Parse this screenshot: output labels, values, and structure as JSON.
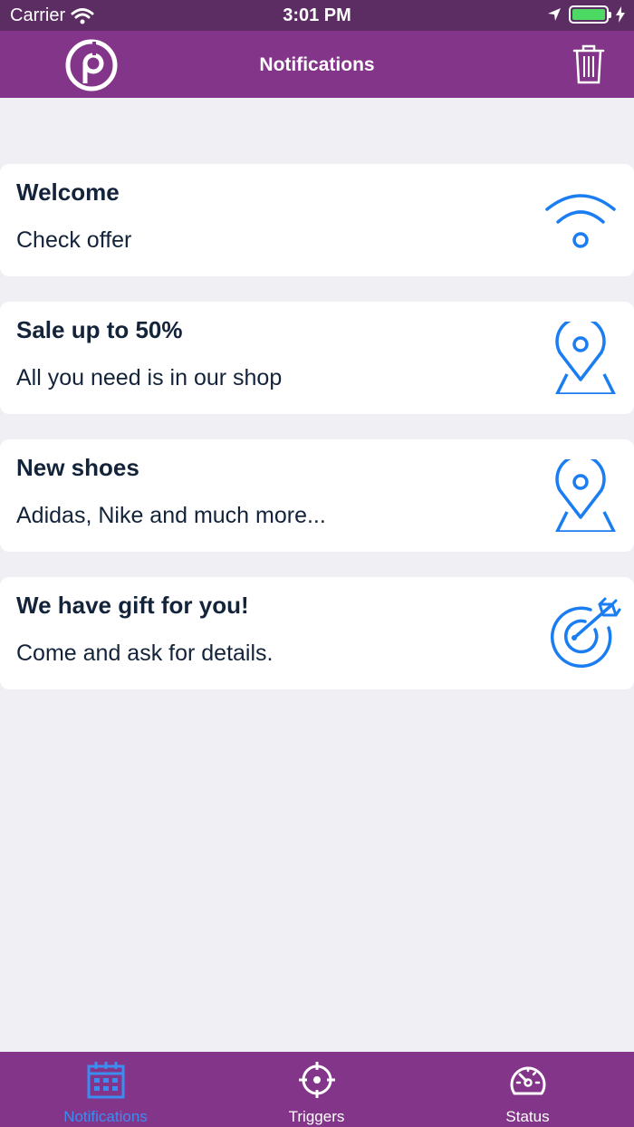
{
  "status_bar": {
    "carrier": "Carrier",
    "time": "3:01 PM"
  },
  "nav": {
    "title": "Notifications"
  },
  "colors": {
    "accent": "#833589",
    "status_bar": "#5b2d63",
    "icon_blue": "#1a7ef2",
    "active_tab": "#3b8df0"
  },
  "notifications": [
    {
      "title": "Welcome",
      "body": "Check offer",
      "icon": "wifi-icon"
    },
    {
      "title": "Sale up to 50%",
      "body": "All you need is in our shop",
      "icon": "location-pin-icon"
    },
    {
      "title": "New shoes",
      "body": "Adidas, Nike and much more...",
      "icon": "location-pin-icon"
    },
    {
      "title": "We have gift for you!",
      "body": "Come and ask for details.",
      "icon": "target-arrow-icon"
    }
  ],
  "tabs": [
    {
      "label": "Notifications",
      "icon": "calendar-icon",
      "active": true
    },
    {
      "label": "Triggers",
      "icon": "crosshair-icon",
      "active": false
    },
    {
      "label": "Status",
      "icon": "speedometer-icon",
      "active": false
    }
  ]
}
